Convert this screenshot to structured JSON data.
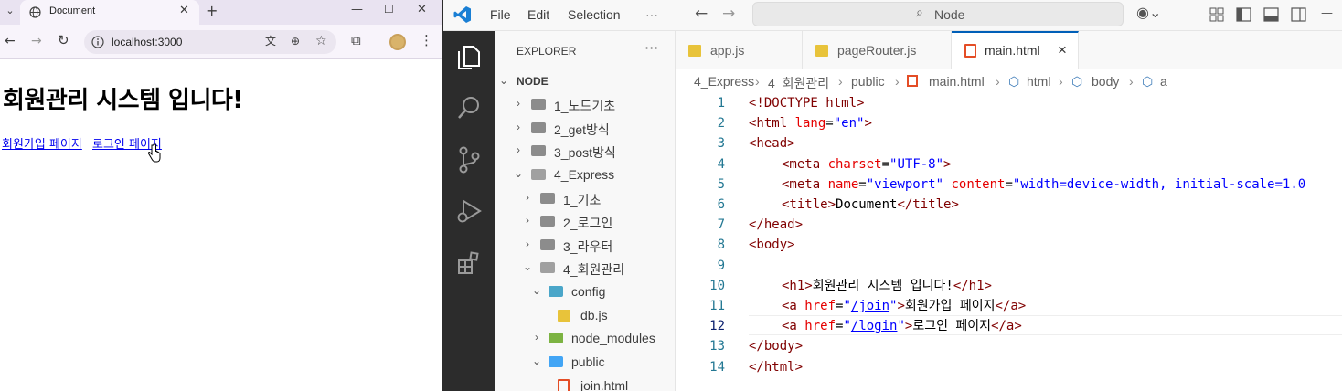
{
  "browser": {
    "tab_title": "Document",
    "url": "localhost:3000",
    "page": {
      "heading": "회원관리 시스템 입니다!",
      "links": [
        "회원가입 페이지",
        "로그인 페이지"
      ]
    }
  },
  "vscode": {
    "menus": [
      "File",
      "Edit",
      "Selection",
      "···"
    ],
    "search_text": "Node",
    "explorer_title": "EXPLORER",
    "root": "NODE",
    "tree": [
      {
        "label": "1_노드기초",
        "kind": "folder",
        "expanded": false
      },
      {
        "label": "2_get방식",
        "kind": "folder",
        "expanded": false
      },
      {
        "label": "3_post방식",
        "kind": "folder",
        "expanded": false
      },
      {
        "label": "4_Express",
        "kind": "folder",
        "expanded": true
      },
      {
        "label": "1_기초",
        "kind": "folder",
        "expanded": false
      },
      {
        "label": "2_로그인",
        "kind": "folder",
        "expanded": false
      },
      {
        "label": "3_라우터",
        "kind": "folder",
        "expanded": false
      },
      {
        "label": "4_회원관리",
        "kind": "folder",
        "expanded": true
      },
      {
        "label": "config",
        "kind": "folder",
        "expanded": true
      },
      {
        "label": "db.js",
        "kind": "file"
      },
      {
        "label": "node_modules",
        "kind": "folder",
        "expanded": false
      },
      {
        "label": "public",
        "kind": "folder",
        "expanded": true
      },
      {
        "label": "join.html",
        "kind": "file"
      }
    ],
    "tabs": [
      {
        "label": "app.js",
        "active": false
      },
      {
        "label": "pageRouter.js",
        "active": false
      },
      {
        "label": "main.html",
        "active": true,
        "close": "×"
      }
    ],
    "breadcrumb": [
      "4_Express",
      "4_회원관리",
      "public",
      "main.html",
      "html",
      "body",
      "a"
    ],
    "line_numbers": [
      "1",
      "2",
      "3",
      "4",
      "5",
      "6",
      "7",
      "8",
      "9",
      "10",
      "11",
      "12",
      "13",
      "14"
    ],
    "code": {
      "l1": [
        "<!DOCTYPE html>"
      ],
      "l2": [
        "<html ",
        "lang",
        "=",
        "\"en\"",
        ">"
      ],
      "l3": [
        "<head>"
      ],
      "l4": [
        "<meta ",
        "charset",
        "=",
        "\"UTF-8\"",
        ">"
      ],
      "l5": [
        "<meta ",
        "name",
        "=",
        "\"viewport\"",
        " content",
        "=",
        "\"width=device-width, initial-scale=1.0"
      ],
      "l6": [
        "<title>",
        "Document",
        "</title>"
      ],
      "l7": [
        "</head>"
      ],
      "l8": [
        "<body>"
      ],
      "l10": [
        "<h1>",
        "회원관리 시스템 입니다!",
        "</h1>"
      ],
      "l11": [
        "<a ",
        "href",
        "=",
        "\"",
        "/join",
        "\"",
        ">",
        "회원가입 페이지",
        "</a>"
      ],
      "l12": [
        "<a ",
        "href",
        "=",
        "\"",
        "/login",
        "\"",
        ">",
        "로그인 페이지",
        "</a>"
      ],
      "l13": [
        "</body>"
      ],
      "l14": [
        "</html>"
      ]
    }
  }
}
